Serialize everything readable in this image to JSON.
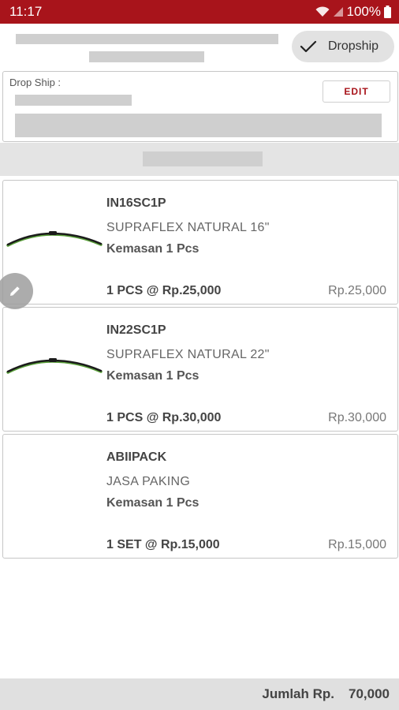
{
  "status_bar": {
    "time": "11:17",
    "battery": "100%",
    "bg_color": "#a8141b"
  },
  "header": {
    "dropship_toggle_label": "Dropship",
    "check_icon": "check-icon"
  },
  "dropship_box": {
    "title": "Drop Ship :",
    "edit_label": "EDIT"
  },
  "items": [
    {
      "code": "IN16SC1P",
      "name": "SUPRAFLEX NATURAL 16\"",
      "pack": "Kemasan 1 Pcs",
      "qty_price": "1 PCS @ Rp.25,000",
      "total": "Rp.25,000",
      "image": "wiper-blade"
    },
    {
      "code": "IN22SC1P",
      "name": "SUPRAFLEX NATURAL 22\"",
      "pack": "Kemasan 1 Pcs",
      "qty_price": "1 PCS @ Rp.30,000",
      "total": "Rp.30,000",
      "image": "wiper-blade"
    },
    {
      "code": "ABIIPACK",
      "name": "JASA PAKING",
      "pack": "Kemasan 1 Pcs",
      "qty_price": "1 SET @ Rp.15,000",
      "total": "Rp.15,000",
      "image": ""
    }
  ],
  "footer": {
    "total_label": "Jumlah Rp.",
    "total_value": "70,000"
  }
}
